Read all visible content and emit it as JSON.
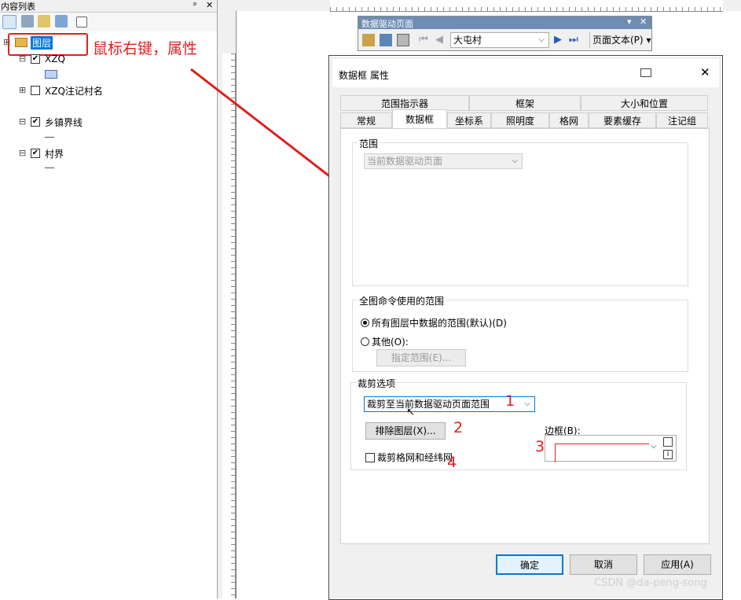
{
  "toc": {
    "title": "内容列表",
    "pin_glyph": "ᵖ",
    "close_glyph": "✕",
    "root_layer": "图层",
    "layers": [
      {
        "name": "XZQ",
        "checked": true
      },
      {
        "name": "XZQ注记村名",
        "checked": false
      },
      {
        "name": "乡镇界线",
        "checked": true
      },
      {
        "name": "村界",
        "checked": true
      }
    ],
    "expander_glyph": "⊟",
    "expander_plus_glyph": "⊞",
    "check_glyph": "✔"
  },
  "annotation": {
    "text": "鼠标右键，属性",
    "n1": "1",
    "n2": "2",
    "n3": "3",
    "n4": "4"
  },
  "ddp_toolbar": {
    "title": "数据驱动页面",
    "page_value": "大屯村",
    "page_text_label": "页面文本(P)",
    "dropdown_glyph": "▾"
  },
  "dialog": {
    "title": "数据框 属性",
    "close_glyph": "✕",
    "tabs_row1": [
      "范围指示器",
      "框架",
      "大小和位置"
    ],
    "tabs_row2": [
      "常规",
      "数据框",
      "坐标系",
      "照明度",
      "格网",
      "要素缓存",
      "注记组"
    ],
    "extent": {
      "label": "范围",
      "combo_value": "当前数据驱动页面"
    },
    "full_extent": {
      "label": "全图命令使用的范围",
      "option1": "所有图层中数据的范围(默认)(D)",
      "option2": "其他(O):",
      "specify_button": "指定范围(E)..."
    },
    "clip": {
      "label": "裁剪选项",
      "combo_value": "裁剪至当前数据驱动页面范围",
      "exclude_button": "排除图层(X)...",
      "border_label": "边框(B):",
      "grid_checkbox": "裁剪格网和经纬网"
    },
    "buttons": {
      "ok": "确定",
      "cancel": "取消",
      "apply": "应用(A)"
    }
  },
  "watermark": "CSDN @da-peng-song",
  "colors": {
    "annotation_red": "#e02020",
    "selected_blue": "#0078d7",
    "toolbar_title": "#6f8db3"
  }
}
